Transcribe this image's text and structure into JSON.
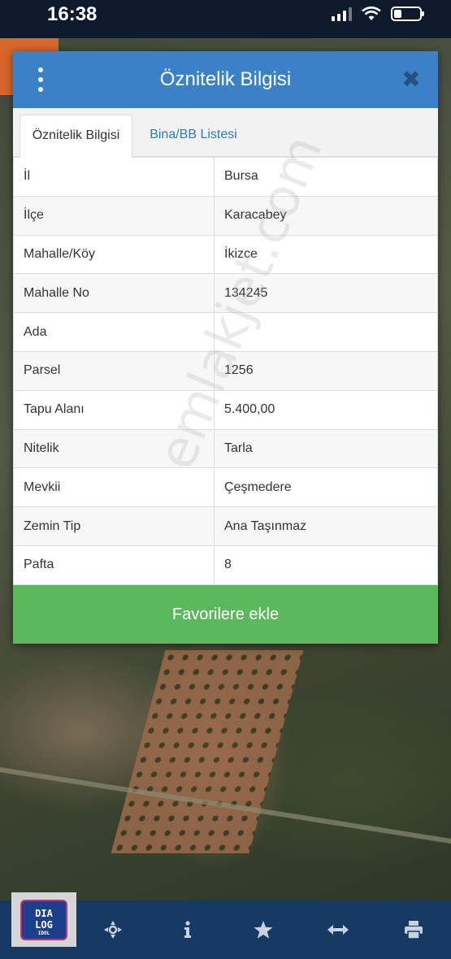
{
  "status_bar": {
    "time": "16:38"
  },
  "dialog": {
    "title": "Öznitelik Bilgisi",
    "tabs": [
      {
        "label": "Öznitelik Bilgisi",
        "active": true
      },
      {
        "label": "Bina/BB Listesi",
        "active": false
      }
    ],
    "rows": [
      {
        "label": "İl",
        "value": "Bursa"
      },
      {
        "label": "İlçe",
        "value": "Karacabey"
      },
      {
        "label": "Mahalle/Köy",
        "value": "İkizce"
      },
      {
        "label": "Mahalle No",
        "value": "134245"
      },
      {
        "label": "Ada",
        "value": ""
      },
      {
        "label": "Parsel",
        "value": "1256"
      },
      {
        "label": "Tapu Alanı",
        "value": "5.400,00"
      },
      {
        "label": "Nitelik",
        "value": "Tarla"
      },
      {
        "label": "Mevkii",
        "value": "Çeşmedere"
      },
      {
        "label": "Zemin Tip",
        "value": "Ana Taşınmaz"
      },
      {
        "label": "Pafta",
        "value": "8"
      }
    ],
    "favorite_button": "Favorilere ekle"
  },
  "watermark": "emlakjet.com",
  "logo": {
    "line1": "DIA",
    "line2": "LOG",
    "sub": "IDOL"
  },
  "toolbar": {
    "icons": [
      "crosshair-icon",
      "info-icon",
      "star-icon",
      "arrows-horizontal-icon",
      "print-icon"
    ]
  },
  "colors": {
    "header": "#3a81c5",
    "favorite": "#5cb85c",
    "toolbar": "#163a63",
    "tab_link": "#2f7ab8"
  }
}
